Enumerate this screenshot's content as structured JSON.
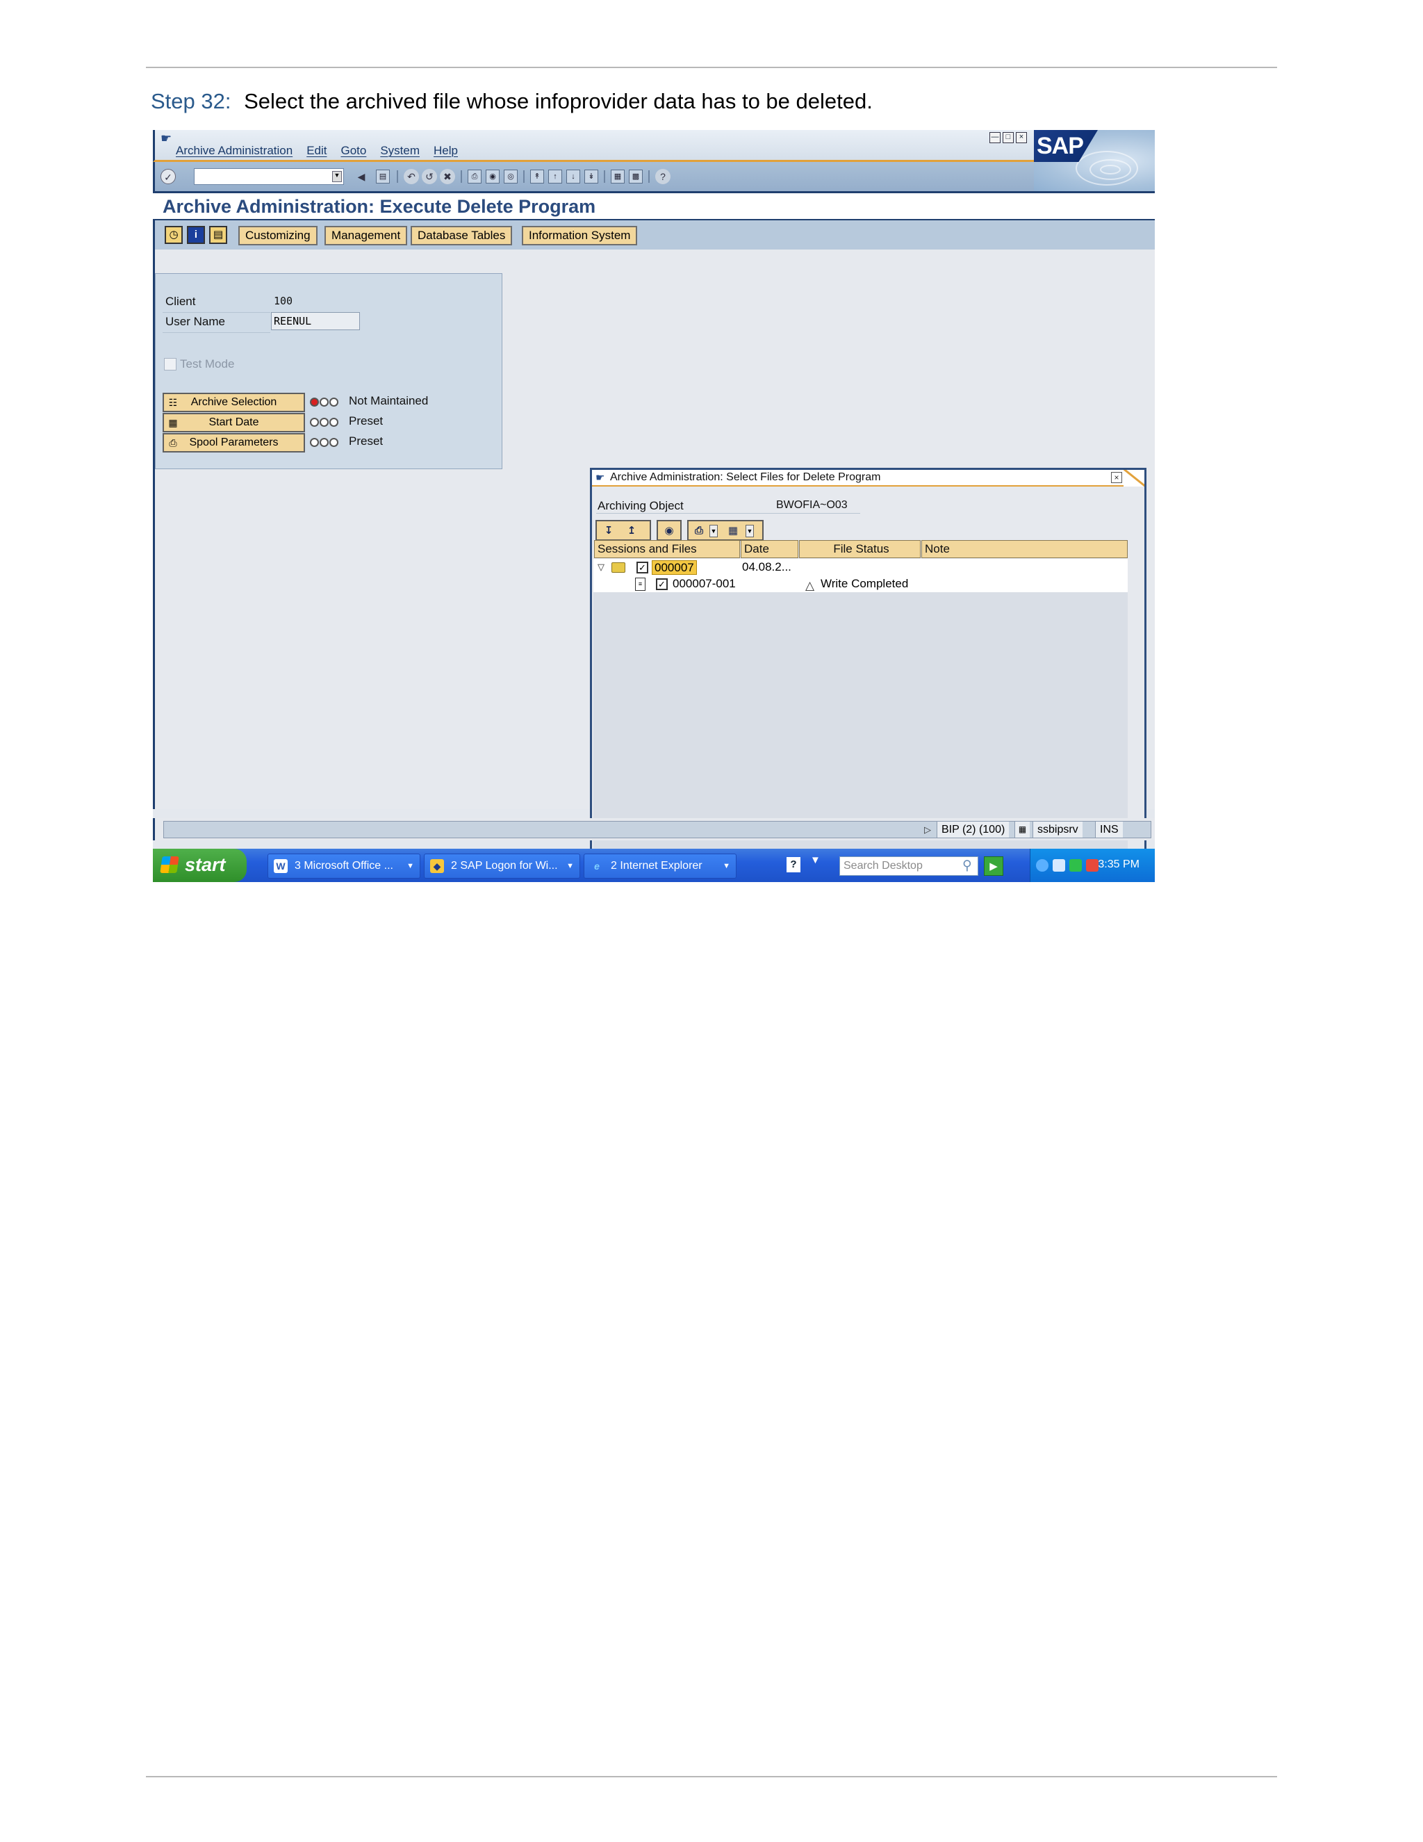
{
  "document": {
    "step_number": "Step 32:",
    "step_text": "Select the archived file whose infoprovider data has to be deleted."
  },
  "sap": {
    "menu": [
      "Archive Administration",
      "Edit",
      "Goto",
      "System",
      "Help"
    ],
    "logo_text": "SAP",
    "screen_title": "Archive Administration: Execute Delete Program",
    "app_toolbar": {
      "buttons": [
        "Customizing",
        "Management",
        "Database Tables",
        "Information System"
      ]
    },
    "params": {
      "client_label": "Client",
      "client_value": "100",
      "user_label": "User Name",
      "user_value": "REENUL",
      "test_mode_label": "Test Mode",
      "rows": [
        {
          "button": "Archive Selection",
          "lights": [
            "red",
            "off",
            "off"
          ],
          "status": "Not Maintained"
        },
        {
          "button": "Start Date",
          "lights": [
            "off",
            "off",
            "off"
          ],
          "status": "Preset"
        },
        {
          "button": "Spool Parameters",
          "lights": [
            "off",
            "off",
            "off"
          ],
          "status": "Preset"
        }
      ]
    },
    "popup": {
      "title": "Archive Administration: Select Files for Delete Program",
      "archiving_object_label": "Archiving Object",
      "archiving_object_value": "BWOFIA~O03",
      "columns": [
        "Sessions and Files",
        "Date",
        "File Status",
        "Note"
      ],
      "rows": [
        {
          "name": "000007",
          "date": "04.08.2...",
          "status": "",
          "checked": true,
          "level": 0
        },
        {
          "name": "000007-001",
          "date": "",
          "status": "Write Completed",
          "checked": true,
          "level": 1
        }
      ]
    },
    "status_bar": {
      "system": "BIP (2) (100)",
      "server": "ssbipsrv",
      "mode": "INS"
    }
  },
  "taskbar": {
    "start_label": "start",
    "tasks": [
      "3 Microsoft Office ...",
      "2 SAP Logon for Wi...",
      "2 Internet Explorer"
    ],
    "search_placeholder": "Search Desktop",
    "clock": "3:35 PM"
  },
  "colors": {
    "step_blue": "#2a5a8c",
    "sap_title": "#2b4b7e",
    "button_yellow": "#f2d79c",
    "frame_blue": "#1f3f6f",
    "accent_orange": "#e2a13a"
  }
}
